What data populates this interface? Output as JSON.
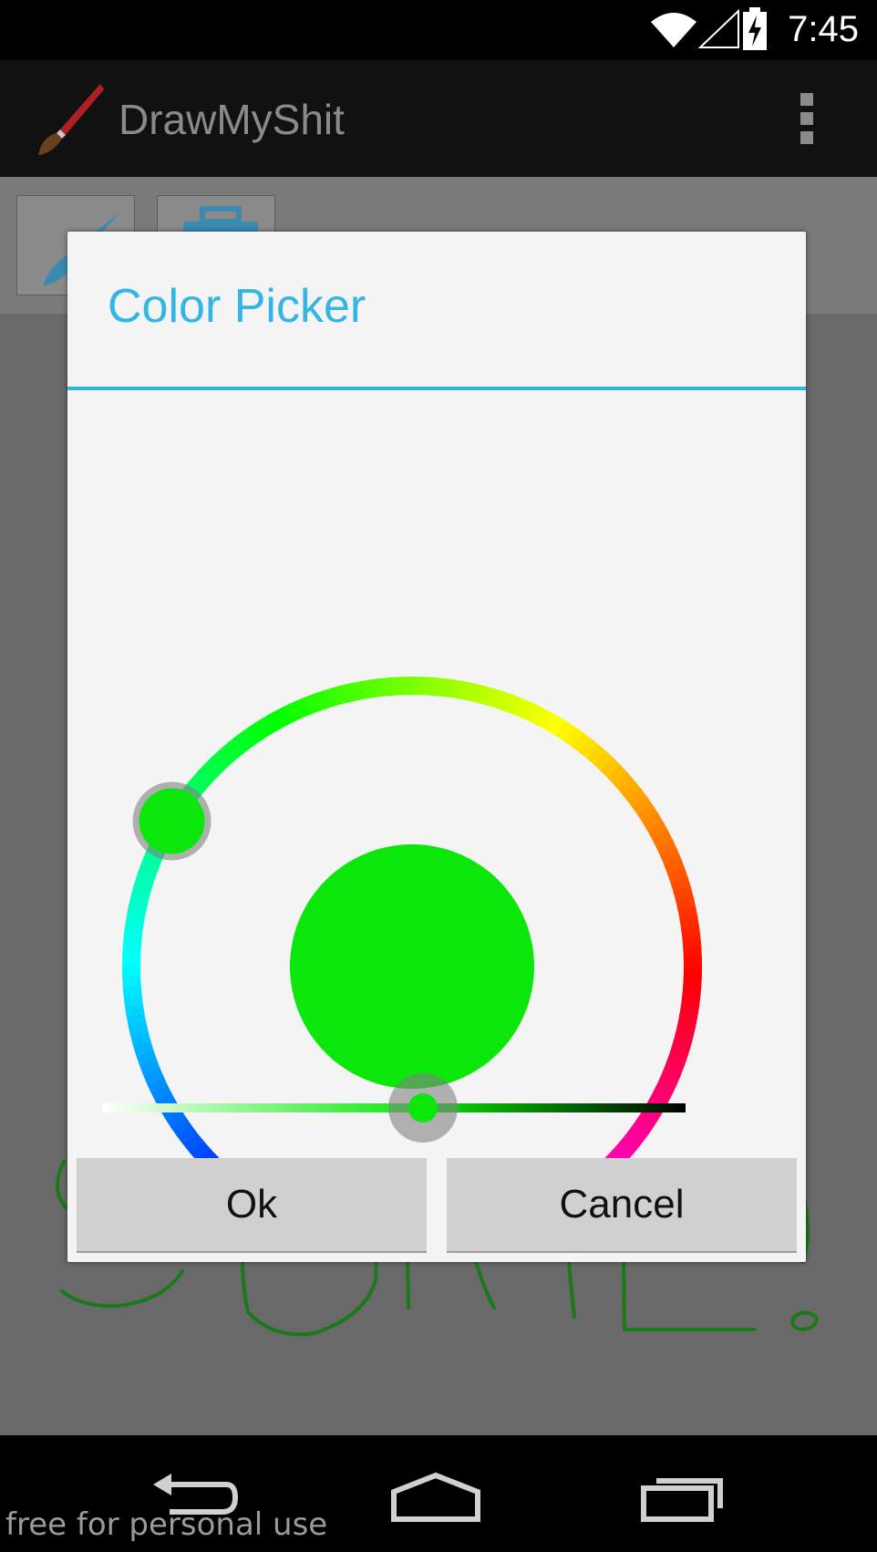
{
  "status_bar": {
    "time": "7:45",
    "icons": [
      "wifi-icon",
      "signal-icon",
      "battery-charging-icon"
    ]
  },
  "action_bar": {
    "app_title": "DrawMyShit",
    "app_icon": "paintbrush-icon",
    "overflow_icon": "overflow-menu-icon"
  },
  "toolbar": {
    "tools": [
      {
        "icon": "brush-icon"
      },
      {
        "icon": "toolbox-icon"
      }
    ]
  },
  "dialog": {
    "title": "Color Picker",
    "selected_color": "#0be60b",
    "accent_color": "#33b5e5",
    "ok_label": "Ok",
    "cancel_label": "Cancel",
    "hue_degrees": 120,
    "value_fraction": 0.55
  },
  "nav_bar": {
    "icons": [
      "back-icon",
      "home-icon",
      "recent-apps-icon"
    ]
  },
  "watermark": "free for personal use"
}
